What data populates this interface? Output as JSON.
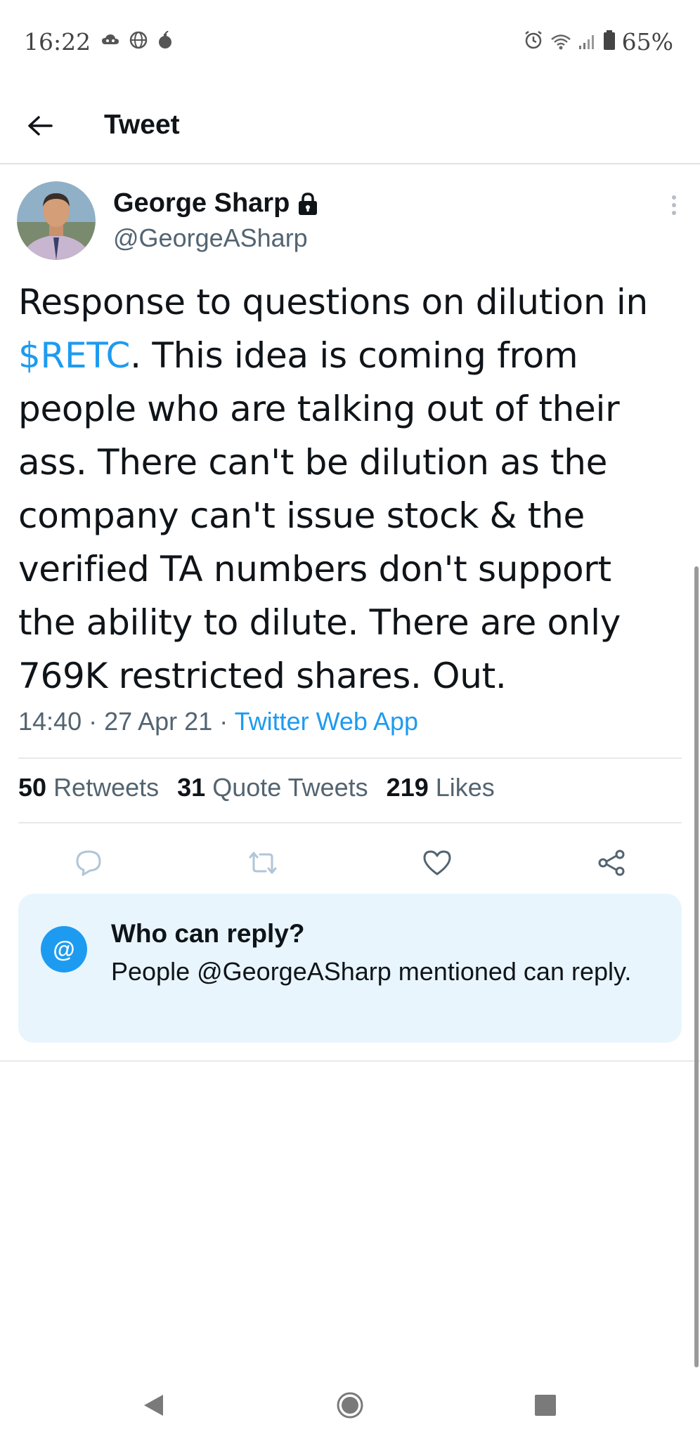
{
  "status_bar": {
    "time": "16:22",
    "battery": "65%",
    "left_icons": [
      "cloud-game-icon",
      "globe-icon",
      "bomb-icon"
    ],
    "right_icons": [
      "alarm-icon",
      "wifi-icon",
      "signal-icon",
      "battery-icon"
    ]
  },
  "header": {
    "title": "Tweet",
    "back_icon": "arrow-left-icon"
  },
  "tweet": {
    "author": {
      "name": "George Sharp",
      "handle": "@GeorgeASharp",
      "protected_icon": "lock-icon"
    },
    "text_before": "Response to questions on dilution in ",
    "cashtag": "$RETC",
    "text_after": ". This idea is coming from people who are talking out of their ass. There can't be dilution as the company can't issue stock & the verified TA numbers don't support the ability to dilute. There are only 769K restricted shares. Out.",
    "time": "14:40",
    "date": "27 Apr 21",
    "separator": " · ",
    "source": "Twitter Web App",
    "stats": {
      "retweets_count": "50",
      "retweets_label": "Retweets",
      "quotes_count": "31",
      "quotes_label": "Quote Tweets",
      "likes_count": "219",
      "likes_label": "Likes"
    }
  },
  "actions": [
    "reply-icon",
    "retweet-icon",
    "like-icon",
    "share-icon"
  ],
  "reply_settings": {
    "icon_text": "@",
    "title": "Who can reply?",
    "description": "People @GeorgeASharp mentioned can reply."
  },
  "colors": {
    "accent": "#1d9bf0",
    "text": "#0f1419",
    "secondary": "#536471",
    "reply_box_bg": "#e8f5fd"
  },
  "nav_bar": [
    "back-triangle-icon",
    "home-circle-icon",
    "recents-square-icon"
  ]
}
